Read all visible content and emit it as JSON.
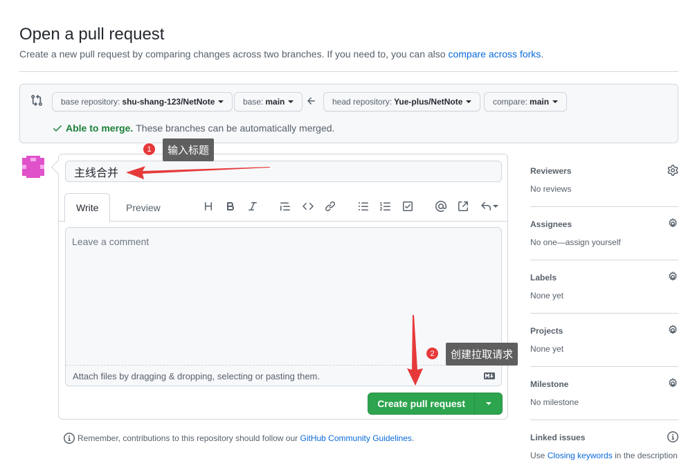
{
  "header": {
    "title": "Open a pull request",
    "subtitle_text": "Create a new pull request by comparing changes across two branches. If you need to, you can also",
    "subtitle_link": "compare across forks",
    "subtitle_end": "."
  },
  "compare": {
    "base_repo_label": "base repository:",
    "base_repo_value": "shu-shang-123/NetNote",
    "base_label": "base:",
    "base_value": "main",
    "head_repo_label": "head repository:",
    "head_repo_value": "Yue-plus/NetNote",
    "compare_label": "compare:",
    "compare_value": "main",
    "merge_ok": "Able to merge.",
    "merge_text": "These branches can be automatically merged."
  },
  "editor": {
    "title_value": "主线合并",
    "tab_write": "Write",
    "tab_preview": "Preview",
    "comment_placeholder": "Leave a comment",
    "attach_text": "Attach files by dragging & dropping, selecting or pasting them.",
    "submit_label": "Create pull request"
  },
  "toolbar": [
    "heading-icon",
    "bold-icon",
    "italic-icon",
    "quote-icon",
    "code-icon",
    "link-icon",
    "unordered-list-icon",
    "ordered-list-icon",
    "task-list-icon",
    "mention-icon",
    "reference-icon",
    "reply-icon"
  ],
  "remember": {
    "text": "Remember, contributions to this repository should follow our",
    "link": "GitHub Community Guidelines",
    "end": "."
  },
  "sidebar": {
    "reviewers": {
      "title": "Reviewers",
      "value": "No reviews"
    },
    "assignees": {
      "title": "Assignees",
      "value": "No one—assign yourself"
    },
    "labels": {
      "title": "Labels",
      "value": "None yet"
    },
    "projects": {
      "title": "Projects",
      "value": "None yet"
    },
    "milestone": {
      "title": "Milestone",
      "value": "No milestone"
    },
    "linked": {
      "title": "Linked issues",
      "value_pre": "Use",
      "value_link": "Closing keywords",
      "value_post": "in the description"
    }
  },
  "annotations": {
    "step1_number": "1",
    "step1_text": "输入标题",
    "step2_number": "2",
    "step2_text": "创建拉取请求"
  },
  "colors": {
    "accent_link": "#0969da",
    "merge_green": "#1a7f37",
    "button_green": "#2da44e",
    "annotation_red": "#e63a3a",
    "avatar_pink": "#e052c9"
  }
}
